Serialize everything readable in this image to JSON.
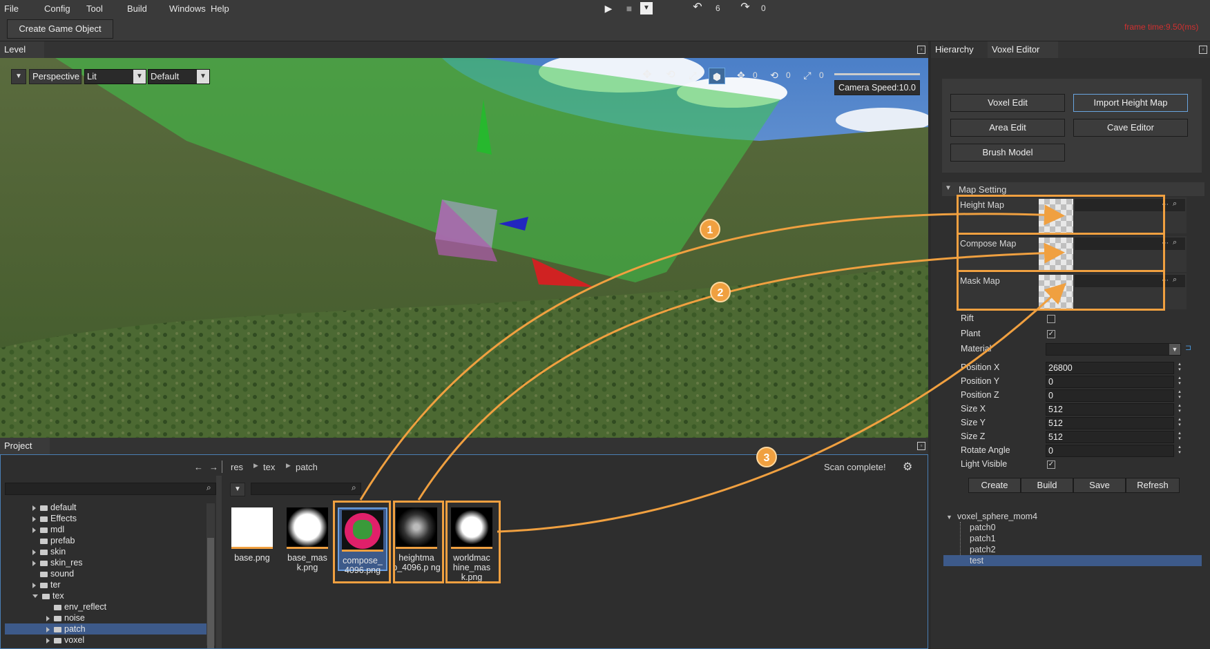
{
  "menu": [
    "File",
    "Config",
    "Tool",
    "Build",
    "Windows",
    "Help"
  ],
  "toolbar": {
    "undo_count": "6",
    "redo_count": "0",
    "create_game_object": "Create Game Object",
    "frame_time": "frame time:9.50(ms)"
  },
  "level_panel": {
    "tab": "Level",
    "perspective": "Perspective",
    "lighting": "Lit",
    "layer": "Default",
    "camera_speed": "Camera Speed:10.0",
    "gizmo_counts": [
      "0",
      "0",
      "0"
    ]
  },
  "project_panel": {
    "tab": "Project",
    "breadcrumb": [
      "res",
      "tex",
      "patch"
    ],
    "status": "Scan complete!",
    "tree": [
      {
        "label": "default",
        "depth": 0,
        "expand": "collapsed"
      },
      {
        "label": "Effects",
        "depth": 0,
        "expand": "collapsed"
      },
      {
        "label": "mdl",
        "depth": 0,
        "expand": "collapsed"
      },
      {
        "label": "prefab",
        "depth": 0,
        "expand": "none"
      },
      {
        "label": "skin",
        "depth": 0,
        "expand": "collapsed"
      },
      {
        "label": "skin_res",
        "depth": 0,
        "expand": "collapsed"
      },
      {
        "label": "sound",
        "depth": 0,
        "expand": "none"
      },
      {
        "label": "ter",
        "depth": 0,
        "expand": "collapsed"
      },
      {
        "label": "tex",
        "depth": 0,
        "expand": "expanded"
      },
      {
        "label": "env_reflect",
        "depth": 1,
        "expand": "none"
      },
      {
        "label": "noise",
        "depth": 1,
        "expand": "collapsed"
      },
      {
        "label": "patch",
        "depth": 1,
        "expand": "collapsed",
        "selected": true
      },
      {
        "label": "voxel",
        "depth": 1,
        "expand": "collapsed"
      }
    ],
    "files": [
      {
        "name": "base.png",
        "thumb": "white"
      },
      {
        "name": "base_mas k.png",
        "thumb": "radial"
      },
      {
        "name": "compose_ 4096.png",
        "thumb": "compose",
        "selected": true
      },
      {
        "name": "heightma p_4096.p ng",
        "thumb": "height"
      },
      {
        "name": "worldmac hine_mas k.png",
        "thumb": "mask"
      }
    ]
  },
  "right_panel": {
    "tabs": [
      "Hierarchy",
      "Voxel Editor"
    ],
    "buttons": [
      "Voxel Edit",
      "Import Height Map",
      "Area Edit",
      "Cave Editor",
      "Brush Model"
    ],
    "map_setting_title": "Map Setting",
    "maps": [
      "Height Map",
      "Compose Map",
      "Mask Map"
    ],
    "props": {
      "rift": "Rift",
      "plant": "Plant",
      "material": "Material",
      "position_x": {
        "label": "Position X",
        "value": "26800"
      },
      "position_y": {
        "label": "Position Y",
        "value": "0"
      },
      "position_z": {
        "label": "Position Z",
        "value": "0"
      },
      "size_x": {
        "label": "Size X",
        "value": "512"
      },
      "size_y": {
        "label": "Size Y",
        "value": "512"
      },
      "size_z": {
        "label": "Size Z",
        "value": "512"
      },
      "rotate_angle": {
        "label": "Rotate Angle",
        "value": "0"
      },
      "light_visible": "Light Visible"
    },
    "plant_checked": true,
    "light_visible_checked": true,
    "actions": [
      "Create",
      "Build",
      "Save",
      "Refresh"
    ],
    "hierarchy": {
      "root": "voxel_sphere_mom4",
      "children": [
        "patch0",
        "patch1",
        "patch2",
        "test"
      ],
      "selected": "test"
    }
  },
  "annotations": [
    "1",
    "2",
    "3"
  ],
  "colors": {
    "accent": "#f0a040",
    "selection": "#3d5a8a",
    "frame_time": "#d03030"
  }
}
